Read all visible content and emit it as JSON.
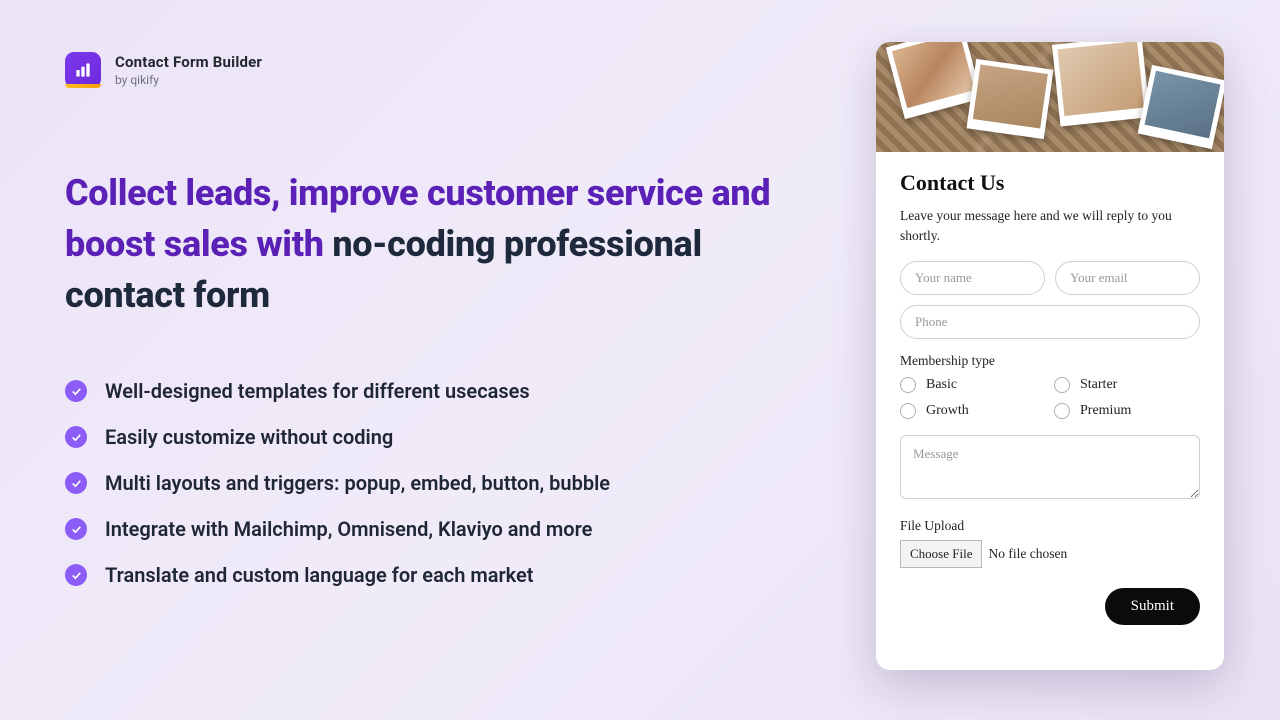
{
  "brand": {
    "title": "Contact Form Builder",
    "subtitle": "by qikify"
  },
  "headline": {
    "accent": "Collect leads, improve customer service and boost sales with",
    "rest": "no-coding professional contact form"
  },
  "bullets": [
    "Well-designed templates for different usecases",
    "Easily customize without coding",
    "Multi layouts and triggers: popup, embed, button, bubble",
    "Integrate with Mailchimp, Omnisend, Klaviyo and more",
    "Translate and custom language for each market"
  ],
  "form": {
    "title": "Contact Us",
    "description": "Leave your message here and we will reply to you shortly.",
    "name_placeholder": "Your name",
    "email_placeholder": "Your email",
    "phone_placeholder": "Phone",
    "membership_label": "Membership type",
    "membership_options": [
      "Basic",
      "Starter",
      "Growth",
      "Premium"
    ],
    "message_placeholder": "Message",
    "file_label": "File Upload",
    "choose_file_label": "Choose File",
    "file_status": "No file chosen",
    "submit_label": "Submit"
  }
}
